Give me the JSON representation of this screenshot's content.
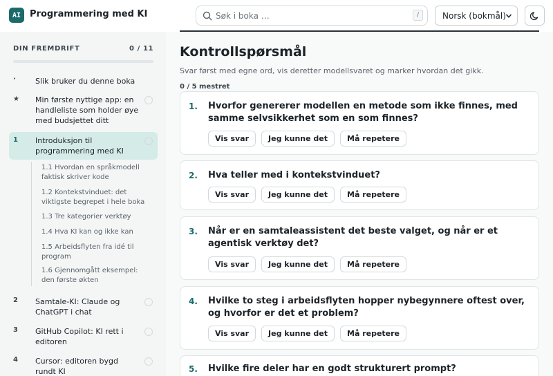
{
  "header": {
    "logo_text": "AI",
    "title": "Programmering med KI",
    "search_placeholder": "Søk i boka …",
    "search_shortcut": "/",
    "language": "Norsk (bokmål)",
    "theme_icon": "moon-icon"
  },
  "sidebar": {
    "progress_label": "DIN FREMDRIFT",
    "progress_count": "0 / 11",
    "progress_fraction": 0,
    "chapters": [
      {
        "num": "·",
        "title": "Slik bruker du denne boka"
      },
      {
        "num": "★",
        "title": "Min første nyttige app: en handleliste som holder øye med budsjettet ditt"
      },
      {
        "num": "1",
        "title": "Introduksjon til programmering med KI"
      },
      {
        "num": "2",
        "title": "Samtale-KI: Claude og ChatGPT i chat"
      },
      {
        "num": "3",
        "title": "GitHub Copilot: KI rett i editoren"
      },
      {
        "num": "4",
        "title": "Cursor: editoren bygd rundt KI"
      }
    ],
    "subsections": [
      "1.1  Hvordan en språkmodell faktisk skriver kode",
      "1.2  Kontekstvinduet: det viktigste begrepet i hele boka",
      "1.3  Tre kategorier verktøy",
      "1.4  Hva KI kan og ikke kan",
      "1.5  Arbeidsflyten fra idé til program",
      "1.6  Gjennomgått eksempel: den første økten"
    ]
  },
  "main": {
    "heading": "Kontrollspørsmål",
    "intro": "Svar først med egne ord, vis deretter modellsvaret og marker hvordan det gikk.",
    "mastered": "0 / 5 mestret",
    "buttons": {
      "show": "Vis svar",
      "knew": "Jeg kunne det",
      "repeat": "Må repetere"
    },
    "questions": [
      {
        "num": "1.",
        "text": "Hvorfor genererer modellen en metode som ikke finnes, med samme selvsikkerhet som en som finnes?"
      },
      {
        "num": "2.",
        "text": "Hva teller med i kontekstvinduet?"
      },
      {
        "num": "3.",
        "text": "Når er en samtaleassistent det beste valget, og når er et agentisk verktøy det?"
      },
      {
        "num": "4.",
        "text": "Hvilke to steg i arbeidsflyten hopper nybegynnere oftest over, og hvorfor er det et problem?"
      },
      {
        "num": "5.",
        "text": "Hvilke fire deler har en godt strukturert prompt?"
      }
    ]
  },
  "colors": {
    "accent": "#1c6b6b",
    "active_bg": "#d5ebe8"
  }
}
